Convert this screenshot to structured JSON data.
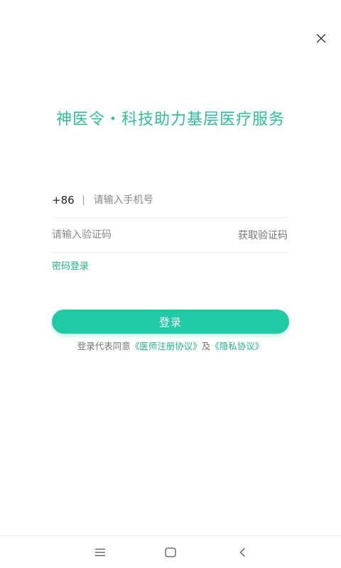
{
  "header": {
    "close_icon": "close-icon"
  },
  "slogan": "神医令・科技助力基层医疗服务",
  "phone": {
    "country_code": "+86",
    "placeholder": "请输入手机号",
    "value": ""
  },
  "code": {
    "placeholder": "请输入验证码",
    "value": "",
    "get_code_label": "获取验证码"
  },
  "password_login_label": "密码登录",
  "login_button_label": "登录",
  "agreement": {
    "prefix": "登录代表同意",
    "doctor_agreement": "《医师注册协议》",
    "conjunction": "及",
    "privacy_agreement": "《隐私协议》"
  },
  "navbar": {
    "items": [
      "menu-icon",
      "home-icon",
      "back-icon"
    ]
  },
  "colors": {
    "accent": "#1fcaa5",
    "accent_text": "#20b38f",
    "slogan": "#2bbf9b"
  }
}
